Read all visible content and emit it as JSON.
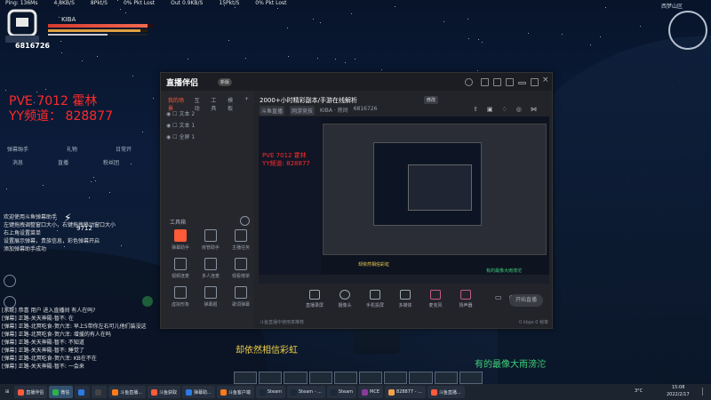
{
  "top_stats": {
    "ping": "Ping: 136Ms",
    "in": "4.8KB/S",
    "inpkt": "8Pkt/S",
    "inlost": "0% Pkt Lost",
    "out": "Out 0.9KB/S",
    "outpkt": "15Pkt/S",
    "outlost": "0% Pkt Lost"
  },
  "player": {
    "name": "KIBA",
    "hp_fraction": 0.95,
    "mp_fraction": 0.93,
    "xp_fraction": 0.6,
    "room_id": "6816726"
  },
  "stream_title": {
    "line1": "PVE 7012 霍林",
    "line2": "YY频道： 828877"
  },
  "left_panel": {
    "tools": [
      "弹幕助手",
      "礼物",
      "日常开"
    ],
    "tools2": [
      "消息",
      "直播",
      "粉丝团"
    ],
    "chat": "欢迎使用斗鱼弹幕助手\n左键拖拽调整窗口大小，右键拖拽移动窗口大小\n右上角设置菜单\n设置展示弹幕，贵族信息，彩色弹幕开启\n添加弹幕助手成功",
    "count": "9712",
    "bottom_chat": [
      "[系统] 恭喜 用户 进入直播间 有人在吗?",
      "[弹幕] 正路-关天神殿-暂不: 在",
      "[弹幕] 正路-北冥吃食-贺六浑: 早上5带你左右可儿他们装没这",
      "[弹幕] 正路-北冥吃食-贺六浑: 增援的有人在吗",
      "[弹幕] 正路-关天神殿-暂不: 不知道",
      "[弹幕] 正路-关天神殿-暂不: 睡觉了",
      "[弹幕] 正路-北冥吃食-贺六浑: KB在不在",
      "[弹幕] 正路-关天神殿-暂不: 一会来"
    ]
  },
  "corner": {
    "season": "西梦山区"
  },
  "subtitles": {
    "left": "却依然相信彩虹",
    "right": "有的最像大雨滂沱"
  },
  "app": {
    "logo": "直播伴侣",
    "badge": "新版",
    "tabs": [
      "我的场景",
      "互动",
      "工具",
      "模板"
    ],
    "scenes": [
      "文本 2",
      "文本 1",
      "全屏 1"
    ],
    "tools_label": "工具箱",
    "tool_items": [
      {
        "label": "弹幕助手",
        "hot": true
      },
      {
        "label": "房管助手",
        "hot": false
      },
      {
        "label": "主播任务",
        "hot": false
      },
      {
        "label": "视频连麦",
        "hot": false
      },
      {
        "label": "多人连麦",
        "hot": false
      },
      {
        "label": "观看榜单",
        "hot": false
      },
      {
        "label": "虚拟形象",
        "hot": false
      },
      {
        "label": "弹幕姬",
        "hot": false
      },
      {
        "label": "歌词弹幕",
        "hot": false
      }
    ],
    "live_title": "2000+小时精彩副本/手游在线解析",
    "live_title_tag": "修改",
    "meta": [
      "斗鱼直播",
      "网游竞技",
      "KIBA · 房间",
      "6816726"
    ],
    "preview_text": "PVE 7012 霍林\nYY频道: 828877",
    "preview_yellow": "却依然相信彩虹",
    "preview_green": "有的最像大雨滂沱",
    "controls": [
      "直播录屏",
      "摄像头",
      "手机投屏",
      "多媒体",
      "麦克风",
      "扬声器"
    ],
    "start_live": "开始直播",
    "status_left": "斗鱼直播中使用率推荐",
    "status_right": "0  kbps  0 帧率"
  },
  "taskbar": {
    "items": [
      {
        "label": "直播伴侣",
        "color": "#ff5a3a",
        "active": false
      },
      {
        "label": "微信",
        "color": "#2bb24c",
        "active": true
      },
      {
        "label": "",
        "color": "#2c7be5",
        "active": false
      },
      {
        "label": "",
        "color": "#444",
        "active": false
      },
      {
        "label": "斗鱼直播...",
        "color": "#ff7a1a",
        "active": false
      },
      {
        "label": "斗鱼获取",
        "color": "#ff5a3a",
        "active": false
      },
      {
        "label": "弹幕助...",
        "color": "#2c7be5",
        "active": false
      },
      {
        "label": "斗鱼客户端",
        "color": "#ff7a1a",
        "active": false
      },
      {
        "label": "Steam",
        "color": "#1b2838",
        "active": false
      },
      {
        "label": "Steam - ...",
        "color": "#1b2838",
        "active": false
      },
      {
        "label": "Steam",
        "color": "#1b2838",
        "active": false
      },
      {
        "label": "MCE",
        "color": "#8a3a9a",
        "active": false
      },
      {
        "label": "828877 - ...",
        "color": "#f2a14a",
        "active": false
      },
      {
        "label": "斗鱼直播...",
        "color": "#ff5a3a",
        "active": false
      }
    ],
    "temp": "3°C",
    "time": "15:08",
    "date": "2022/2/17"
  }
}
